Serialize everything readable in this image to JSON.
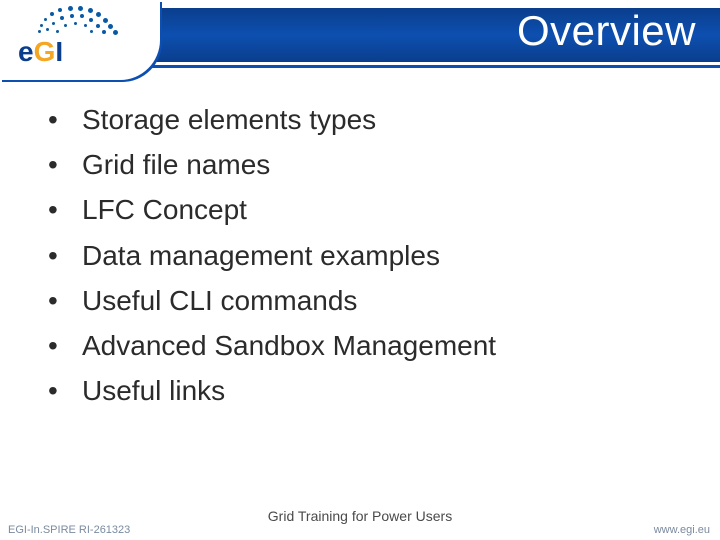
{
  "header": {
    "title": "Overview",
    "logo_text_e": "e",
    "logo_text_g": "G",
    "logo_text_i": "I"
  },
  "bullets": [
    "Storage elements types",
    "Grid file names",
    "LFC Concept",
    "Data management examples",
    "Useful CLI commands",
    "Advanced Sandbox Management",
    "Useful links"
  ],
  "footer": {
    "left": "EGI-In.SPIRE RI-261323",
    "center": "Grid Training for Power Users",
    "right": "www.egi.eu"
  }
}
